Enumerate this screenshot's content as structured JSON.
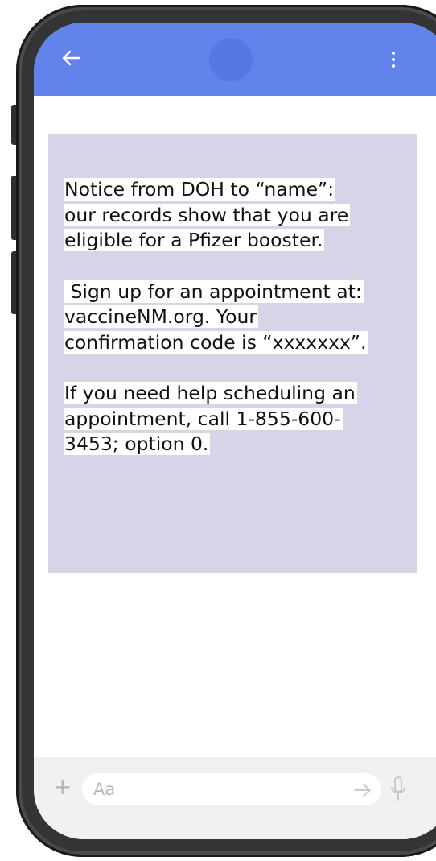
{
  "app_bar": {
    "color": "#6283ec",
    "back_icon": "arrow-left-icon",
    "menu_icon": "more-vertical-icon"
  },
  "message": {
    "bubble_color": "#d9d3e8",
    "paragraphs": [
      {
        "lines": [
          "Notice from DOH to “name”:",
          "our records show that you are",
          "eligible for a Pfizer booster."
        ]
      },
      {
        "lines": [
          " Sign up for an appointment at:",
          "vaccineNM.org. Your",
          "confirmation code is “xxxxxxx”."
        ]
      },
      {
        "lines": [
          "If you need help scheduling an",
          "appointment, call 1-855-600-",
          "3453; option 0."
        ]
      }
    ]
  },
  "composer": {
    "plus_label": "+",
    "placeholder": "Aa",
    "send_icon": "arrow-right-icon",
    "mic_icon": "microphone-icon"
  }
}
